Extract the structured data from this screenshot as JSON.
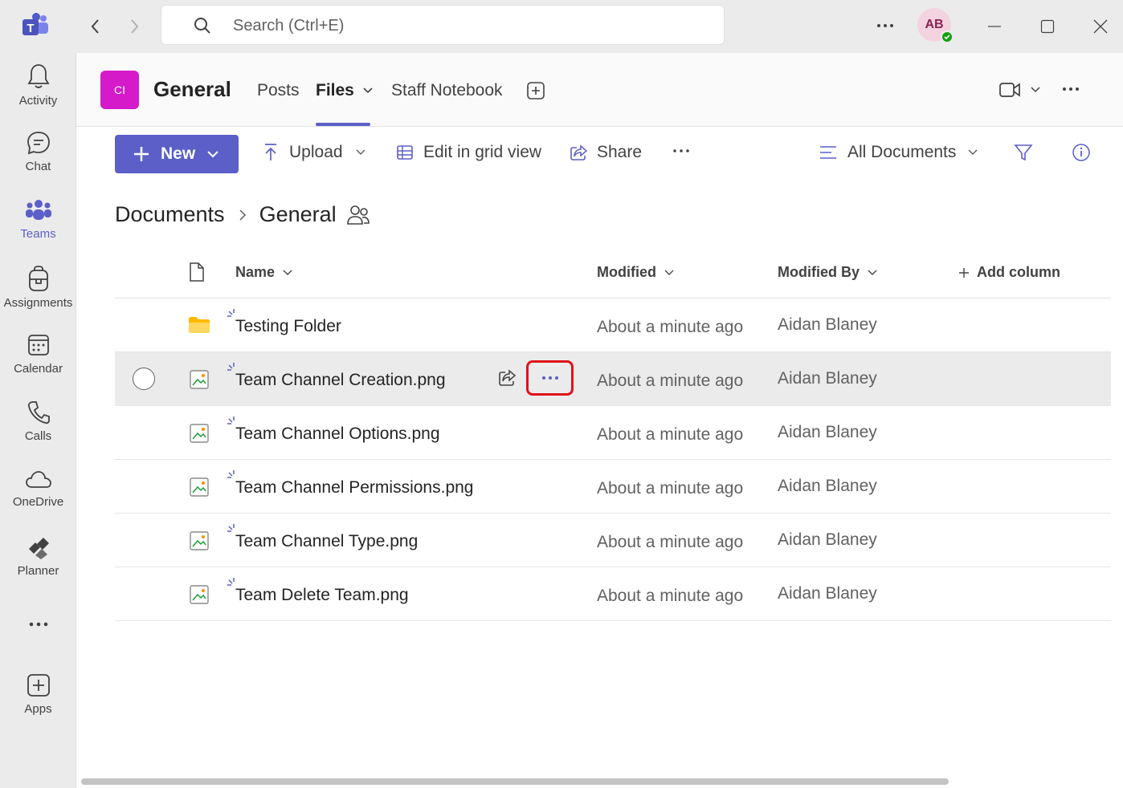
{
  "titlebar": {
    "search_placeholder": "Search (Ctrl+E)",
    "avatar_initials": "AB"
  },
  "rail": {
    "items": [
      {
        "label": "Activity",
        "icon": "bell-icon"
      },
      {
        "label": "Chat",
        "icon": "chat-icon"
      },
      {
        "label": "Teams",
        "icon": "teams-icon",
        "active": true
      },
      {
        "label": "Assignments",
        "icon": "backpack-icon"
      },
      {
        "label": "Calendar",
        "icon": "calendar-icon"
      },
      {
        "label": "Calls",
        "icon": "phone-icon"
      },
      {
        "label": "OneDrive",
        "icon": "cloud-icon"
      },
      {
        "label": "Planner",
        "icon": "planner-icon"
      },
      {
        "label": "Apps",
        "icon": "add-app-icon"
      }
    ]
  },
  "channel": {
    "avatar_text": "CI",
    "name": "General",
    "tabs": [
      "Posts",
      "Files",
      "Staff Notebook"
    ],
    "active_tab": "Files"
  },
  "toolbar": {
    "new_label": "New",
    "upload_label": "Upload",
    "grid_label": "Edit in grid view",
    "share_label": "Share",
    "view_label": "All Documents"
  },
  "breadcrumb": {
    "root": "Documents",
    "current": "General"
  },
  "table": {
    "headers": {
      "name": "Name",
      "modified": "Modified",
      "modified_by": "Modified By",
      "add_column": "Add column"
    },
    "rows": [
      {
        "name": "Testing Folder",
        "type": "folder",
        "modified": "About a minute ago",
        "modified_by": "Aidan Blaney"
      },
      {
        "name": "Team Channel Creation.png",
        "type": "image",
        "modified": "About a minute ago",
        "modified_by": "Aidan Blaney",
        "hovered": true
      },
      {
        "name": "Team Channel Options.png",
        "type": "image",
        "modified": "About a minute ago",
        "modified_by": "Aidan Blaney"
      },
      {
        "name": "Team Channel Permissions.png",
        "type": "image",
        "modified": "About a minute ago",
        "modified_by": "Aidan Blaney"
      },
      {
        "name": "Team Channel Type.png",
        "type": "image",
        "modified": "About a minute ago",
        "modified_by": "Aidan Blaney"
      },
      {
        "name": "Team Delete Team.png",
        "type": "image",
        "modified": "About a minute ago",
        "modified_by": "Aidan Blaney"
      }
    ]
  },
  "colors": {
    "accent": "#5b5fc7",
    "highlight": "#e0121a",
    "channel_avatar": "#d51aca"
  }
}
